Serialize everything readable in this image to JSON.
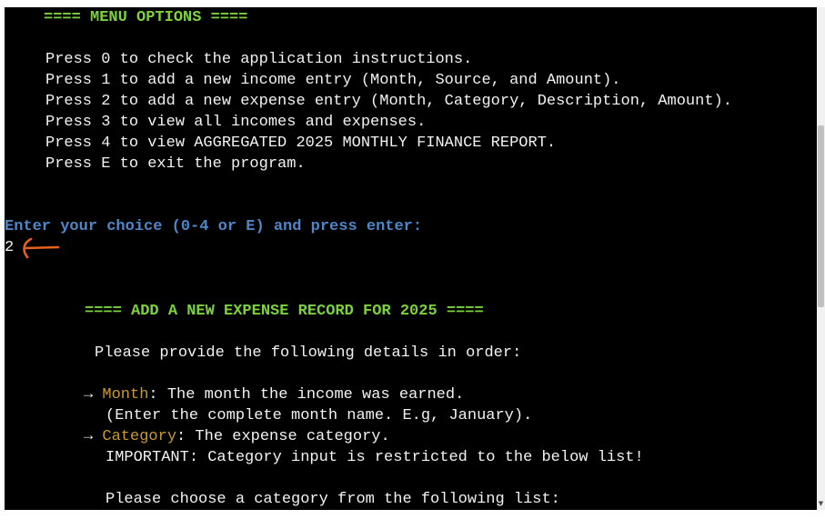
{
  "terminal": {
    "menu_header": "==== MENU OPTIONS ====",
    "menu_items": [
      "Press 0 to check the application instructions.",
      "Press 1 to add a new income entry (Month, Source, and Amount).",
      "Press 2 to add a new expense entry (Month, Category, Description, Amount).",
      "Press 3 to view all incomes and expenses.",
      "Press 4 to view AGGREGATED 2025 MONTHLY FINANCE REPORT.",
      "Press E to exit the program."
    ],
    "prompt": "Enter your choice (0-4 or E) and press enter:",
    "user_input": "2",
    "expense_header": "==== ADD A NEW EXPENSE RECORD FOR 2025 ====",
    "details_intro": "Please provide the following details in order:",
    "arrow_glyph": "→",
    "month_label": "Month",
    "month_desc": ": The month the income was earned.",
    "month_hint": "(Enter the complete month name. E.g, January).",
    "category_label": "Category",
    "category_desc": ": The expense category.",
    "category_important": "IMPORTANT: Category input is restricted to the below list!",
    "category_choose": "Please choose a category from the following list:"
  },
  "annotation": {
    "icon": "hand-drawn-arrow-icon",
    "color": "#e8601c"
  },
  "scrollbar": {
    "down_glyph": "▼"
  },
  "colors": {
    "background": "#000000",
    "text": "#f2f2f2",
    "header_green": "#7cd23a",
    "prompt_blue": "#4f86c6",
    "label_gold": "#c99a2e"
  }
}
